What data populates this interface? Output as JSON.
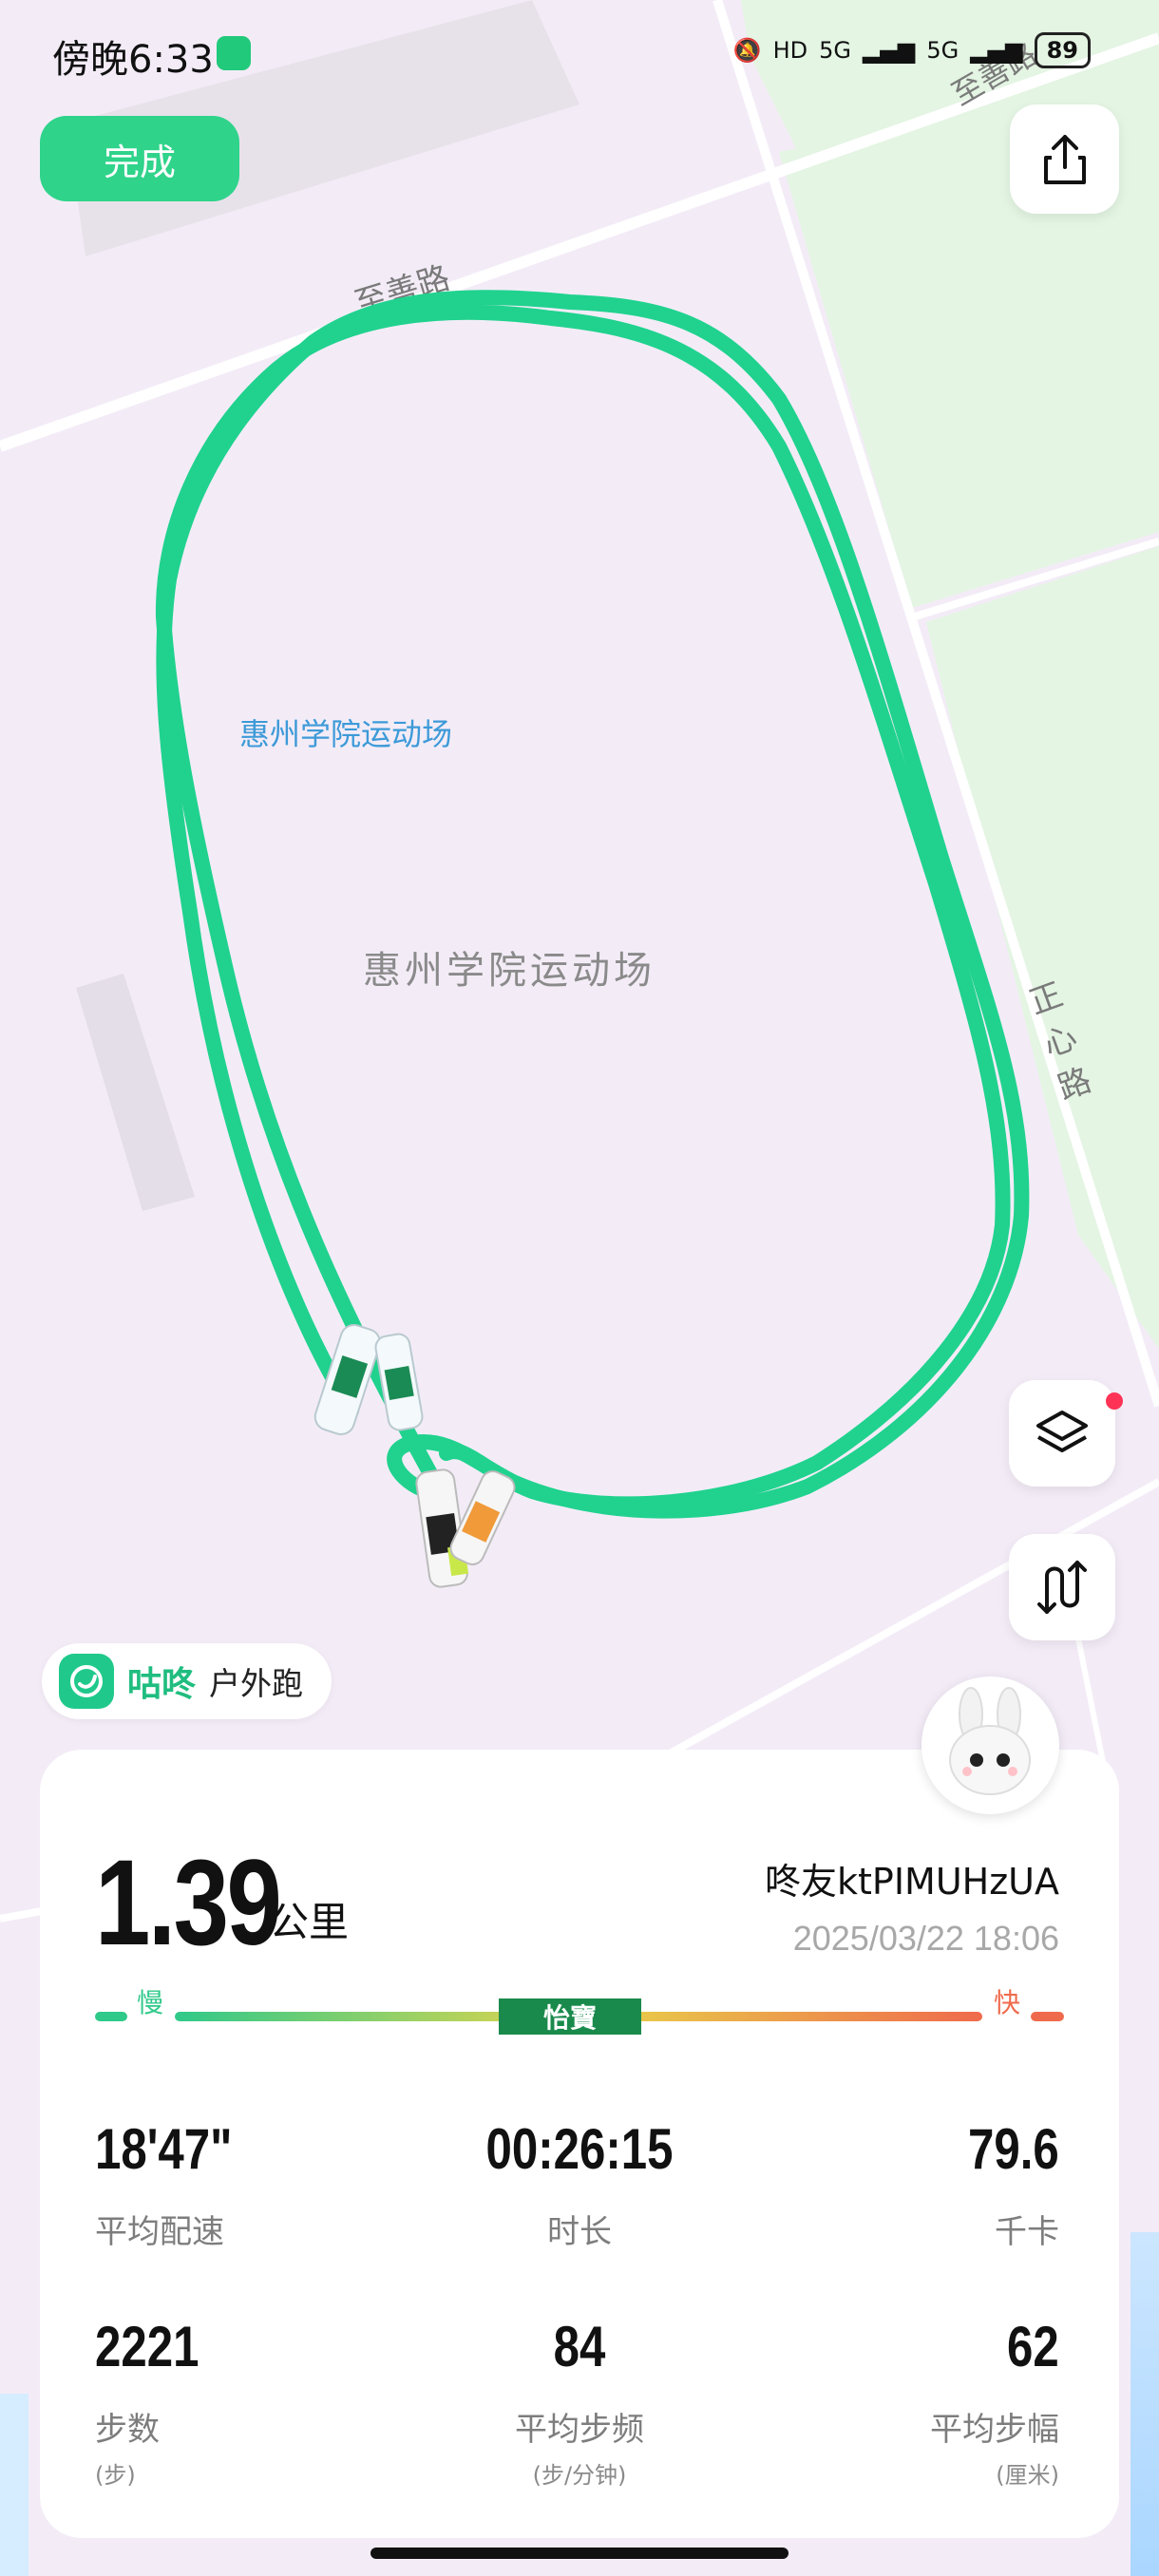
{
  "status_bar": {
    "time": "傍晚6:33",
    "network_a": "5G",
    "network_b": "5G",
    "hd": "HD",
    "battery": "89"
  },
  "header": {
    "done_label": "完成",
    "share_icon": "share-icon"
  },
  "map": {
    "road_top": "至善路",
    "road_top_right": "至善路",
    "road_right": "正心路",
    "poi_label_blue": "惠州学院运动场",
    "poi_label_center": "惠州学院运动场",
    "route_color": "#20d28e"
  },
  "map_controls": {
    "layers_icon": "layers-icon",
    "route_icon": "route-toggle-icon"
  },
  "brand": {
    "name": "咕咚",
    "activity_type": "户外跑"
  },
  "summary": {
    "distance": "1.39",
    "distance_unit": "公里",
    "username": "咚友ktPIMUHzUA",
    "datetime": "2025/03/22 18:06",
    "speed_slow": "慢",
    "speed_fast": "快",
    "sponsor": "怡寶",
    "colors": {
      "slow": "#2fc98a",
      "fast": "#ef6a4c",
      "mid": "#e8d64a"
    }
  },
  "stats": [
    {
      "value": "18'47\"",
      "label": "平均配速",
      "sub": ""
    },
    {
      "value": "00:26:15",
      "label": "时长",
      "sub": ""
    },
    {
      "value": "79.6",
      "label": "千卡",
      "sub": ""
    },
    {
      "value": "2221",
      "label": "步数",
      "sub": "(步)"
    },
    {
      "value": "84",
      "label": "平均步频",
      "sub": "(步/分钟)"
    },
    {
      "value": "62",
      "label": "平均步幅",
      "sub": "(厘米)"
    }
  ]
}
